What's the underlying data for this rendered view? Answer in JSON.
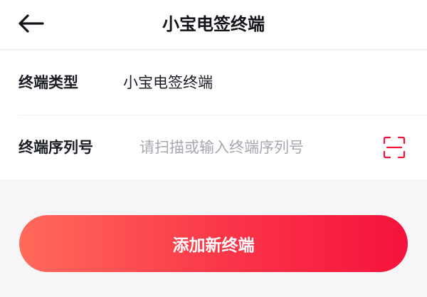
{
  "header": {
    "title": "小宝电签终端",
    "back_icon": "arrow-left-icon"
  },
  "form": {
    "terminal_type": {
      "label": "终端类型",
      "value": "小宝电签终端"
    },
    "serial_number": {
      "label": "终端序列号",
      "value": "",
      "placeholder": "请扫描或输入终端序列号",
      "scan_icon": "scan-icon"
    }
  },
  "actions": {
    "add_label": "添加新终端"
  },
  "colors": {
    "accent": "#f5133c",
    "gradient_start": "#ff6a5a",
    "background": "#f6f6f8"
  }
}
